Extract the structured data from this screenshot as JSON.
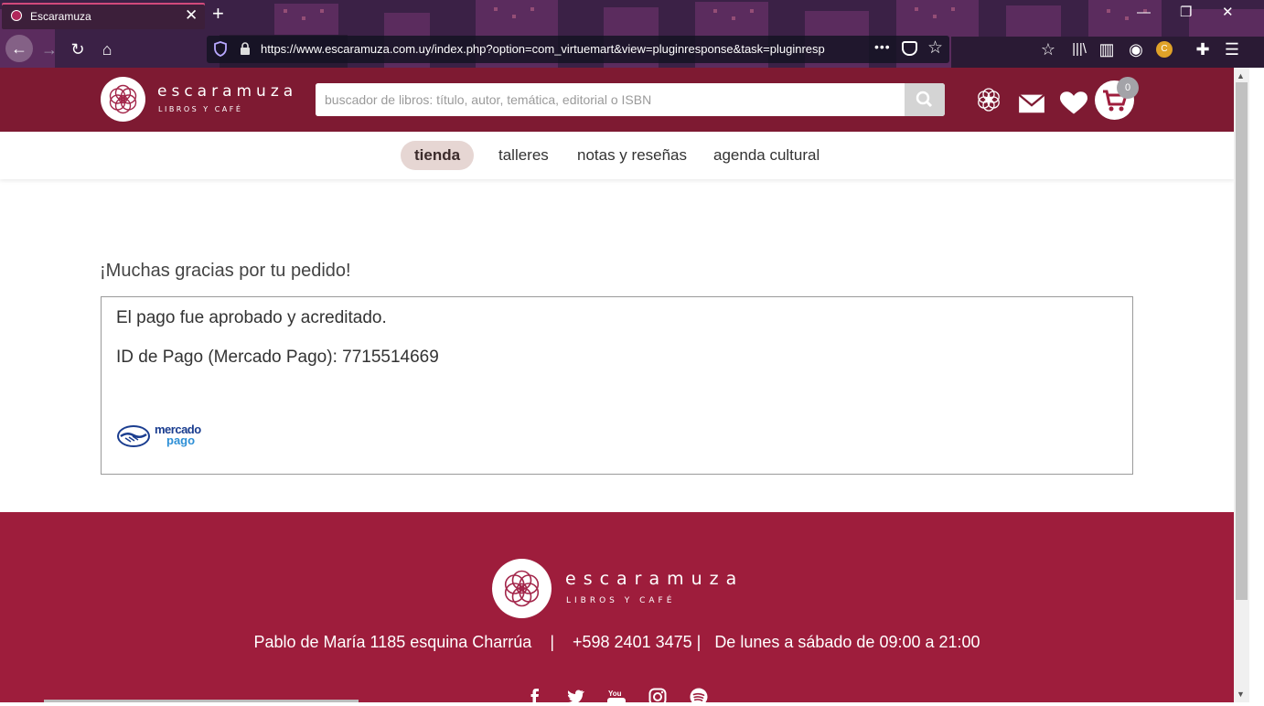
{
  "browser": {
    "tab_title": "Escaramuza",
    "url": "https://www.escaramuza.com.uy/index.php?option=com_virtuemart&view=pluginresponse&task=pluginresp",
    "url_more": "•••"
  },
  "header": {
    "logo_name": "escaramuza",
    "logo_tagline": "LIBROS Y CAFÉ",
    "search_placeholder": "buscador de libros: título, autor, temática, editorial o ISBN",
    "cart_count": "0",
    "icons": [
      "search-icon",
      "flower-icon",
      "mail-icon",
      "heart-icon",
      "cart-icon"
    ]
  },
  "nav": {
    "items": [
      {
        "label": "tienda",
        "active": true
      },
      {
        "label": "talleres"
      },
      {
        "label": "notas y reseñas"
      },
      {
        "label": "agenda cultural"
      }
    ]
  },
  "main": {
    "thanks": "¡Muchas gracias por tu pedido!",
    "approved": "El pago fue aprobado y acreditado.",
    "payment_id_line": "ID de Pago (Mercado Pago): 7715514669",
    "mp_logo_top": "mercado",
    "mp_logo_bottom": "pago"
  },
  "footer": {
    "logo_name": "escaramuza",
    "logo_tagline": "LIBROS Y CAFÉ",
    "info": "Pablo de María 1185 esquina Charrúa    |    +598 2401 3475 |   De lunes a sábado de 09:00 a 21:00",
    "social": [
      "facebook-icon",
      "twitter-icon",
      "youtube-icon",
      "instagram-icon",
      "spotify-icon"
    ]
  },
  "colors": {
    "header_bg": "#7e1a32",
    "footer_bg": "#9e1d3c",
    "nav_active_bg": "#e6d6d3",
    "brand": "#a3264a"
  }
}
